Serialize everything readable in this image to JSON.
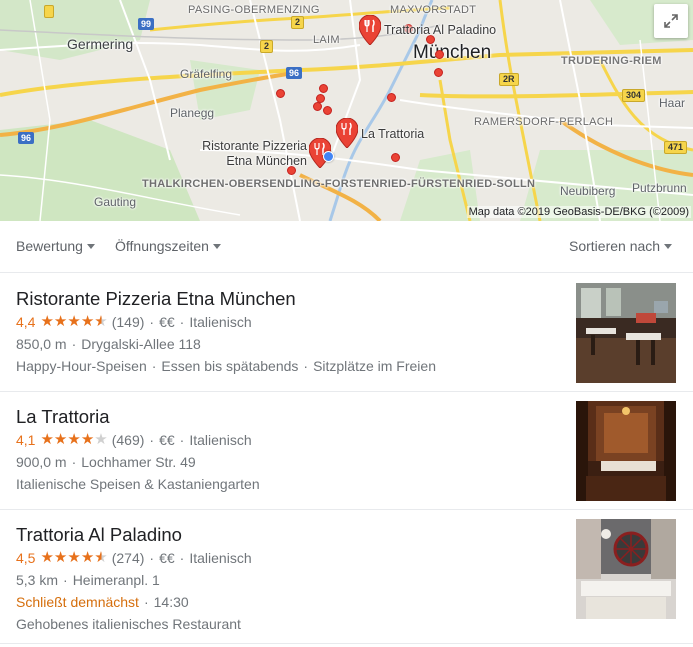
{
  "map": {
    "labels": {
      "pasing": "PASING-OBERMENZING",
      "maxvorstadt": "MAXVORSTADT",
      "germering": "Germering",
      "laim": "LAIM",
      "muenchen": "München",
      "trudering": "TRUDERING-RIEM",
      "graefelfing": "Gräfelfing",
      "planegg": "Planegg",
      "haar": "Haar",
      "ramersdorf": "RAMERSDORF-PERLACH",
      "thalkirchen": "THALKIRCHEN-OBERSENDLING-FORSTENRIED-FÜRSTENRIED-SOLLN",
      "gauting": "Gauting",
      "neubiberg": "Neubiberg",
      "putzbrunn": "Putzbrunn"
    },
    "shields": {
      "s99": "99",
      "s2a": "2",
      "s2b": "2",
      "s96a": "96",
      "s96b": "96",
      "s2r": "2R",
      "s304": "304",
      "s471": "471"
    },
    "places": {
      "paladino": "Trattoria Al Paladino",
      "trattoria": "La Trattoria",
      "etna_line1": "Ristorante Pizzeria",
      "etna_line2": "Etna München"
    },
    "attribution": "Map data ©2019 GeoBasis-DE/BKG (©2009)",
    "expand_icon": "expand-icon"
  },
  "filters": {
    "rating": "Bewertung",
    "hours": "Öffnungszeiten",
    "sort": "Sortieren nach"
  },
  "listings": [
    {
      "name": "Ristorante Pizzeria Etna München",
      "rating": "4,4",
      "rating_value": 4.4,
      "reviews": "(149)",
      "price": "€€",
      "category": "Italienisch",
      "distance": "850,0 m",
      "address": "Drygalski-Allee 118",
      "tags": [
        "Happy-Hour-Speisen",
        "Essen bis spätabends",
        "Sitzplätze im Freien"
      ]
    },
    {
      "name": "La Trattoria",
      "rating": "4,1",
      "rating_value": 4.1,
      "reviews": "(469)",
      "price": "€€",
      "category": "Italienisch",
      "distance": "900,0 m",
      "address": "Lochhamer Str. 49",
      "tags": [
        "Italienische Speisen & Kastaniengarten"
      ]
    },
    {
      "name": "Trattoria Al Paladino",
      "rating": "4,5",
      "rating_value": 4.5,
      "reviews": "(274)",
      "price": "€€",
      "category": "Italienisch",
      "distance": "5,3 km",
      "address": "Heimeranpl. 1",
      "status": "Schließt demnächst",
      "time": "14:30",
      "description": "Gehobenes italienisches Restaurant"
    }
  ],
  "separators": {
    "dot": "·"
  },
  "colors": {
    "accent": "#e7711b",
    "pin": "#ea4335",
    "link": "#1a0dab"
  }
}
